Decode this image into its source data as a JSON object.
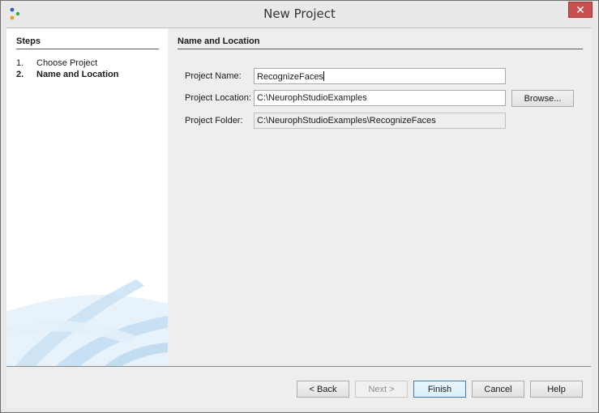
{
  "window": {
    "title": "New Project"
  },
  "steps": {
    "title": "Steps",
    "items": [
      {
        "num": "1.",
        "label": "Choose Project",
        "active": false
      },
      {
        "num": "2.",
        "label": "Name and Location",
        "active": true
      }
    ]
  },
  "main": {
    "section_title": "Name and Location",
    "fields": {
      "project_name": {
        "label": "Project Name:",
        "value": "RecognizeFaces"
      },
      "project_location": {
        "label": "Project Location:",
        "value": "C:\\NeurophStudioExamples"
      },
      "project_folder": {
        "label": "Project Folder:",
        "value": "C:\\NeurophStudioExamples\\RecognizeFaces"
      }
    },
    "browse_label": "Browse..."
  },
  "footer": {
    "back_label": "< Back",
    "next_label": "Next >",
    "finish_label": "Finish",
    "cancel_label": "Cancel",
    "help_label": "Help"
  },
  "colors": {
    "close_button": "#c75050",
    "panel": "#eeeeee",
    "steps_bg": "#ffffff"
  }
}
